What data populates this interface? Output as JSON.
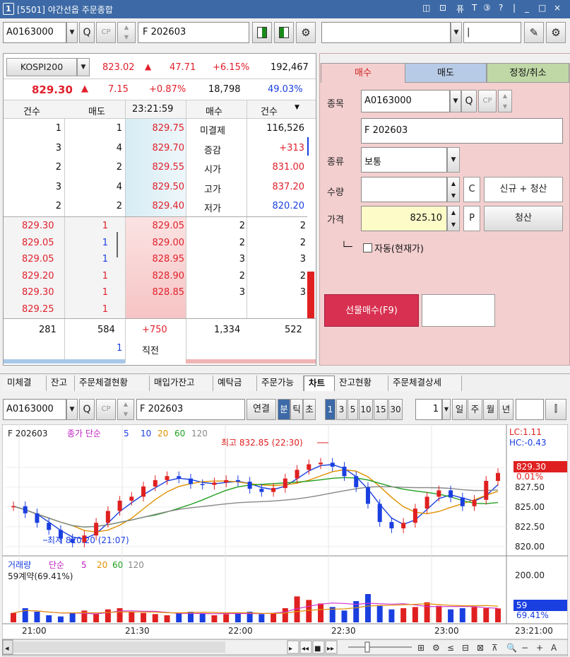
{
  "window": {
    "number": "1",
    "title": "[5501] 야간선옵 주문종합",
    "controls": [
      "◫",
      "⊡",
      "퓨",
      "T",
      "③",
      "?",
      "|",
      "_",
      "□",
      "×"
    ]
  },
  "left_toolbar": {
    "account": "A0163000",
    "product": "F 202603"
  },
  "right_toolbar": {
    "field_text": "|"
  },
  "quote": {
    "index_name": "KOSPI200",
    "index_price": "823.02",
    "index_change": "47.71",
    "index_change_pct": "+6.15%",
    "index_volume": "192,467",
    "price": "829.30",
    "change": "7.15",
    "change_pct": "+0.87%",
    "volume": "18,798",
    "ratio": "49.03%",
    "header": {
      "cnt_sell": "건수",
      "sell": "매도",
      "time": "23:21:59",
      "buy": "매수",
      "cnt_buy": "건수"
    },
    "ask_rows": [
      {
        "cnt": "1",
        "qty": "1",
        "price": "829.75",
        "label": "미결제",
        "value": "116,526"
      },
      {
        "cnt": "3",
        "qty": "4",
        "price": "829.70",
        "label": "증감",
        "value": "+313"
      },
      {
        "cnt": "2",
        "qty": "2",
        "price": "829.55",
        "label": "시가",
        "value": "831.00"
      },
      {
        "cnt": "3",
        "qty": "4",
        "price": "829.50",
        "label": "고가",
        "value": "837.20"
      },
      {
        "cnt": "2",
        "qty": "2",
        "price": "829.40",
        "label": "저가",
        "value": "820.20"
      }
    ],
    "bid_rows": [
      {
        "tick_price": "829.30",
        "tick_qty": "1",
        "price": "829.05",
        "qty": "2",
        "cnt": "2"
      },
      {
        "tick_price": "829.05",
        "tick_qty": "1",
        "price": "829.00",
        "qty": "2",
        "cnt": "2"
      },
      {
        "tick_price": "829.05",
        "tick_qty": "1",
        "price": "828.95",
        "qty": "3",
        "cnt": "3"
      },
      {
        "tick_price": "829.20",
        "tick_qty": "1",
        "price": "828.90",
        "qty": "2",
        "cnt": "2"
      },
      {
        "tick_price": "829.30",
        "tick_qty": "1",
        "price": "828.85",
        "qty": "3",
        "cnt": "3"
      },
      {
        "tick_price": "829.25",
        "tick_qty": "1"
      }
    ],
    "footer": {
      "sell_cnt": "281",
      "sell_total": "584",
      "diff": "+750",
      "buy_total": "1,334",
      "buy_cnt": "522",
      "last_qty": "1",
      "last_label": "직전"
    }
  },
  "order": {
    "tabs": [
      "매수",
      "매도",
      "정정/취소"
    ],
    "labels": {
      "symbol": "종목",
      "type": "종류",
      "qty": "수량",
      "price": "가격"
    },
    "symbol": "A0163000",
    "product": "F 202603",
    "type": "보통",
    "qty": "",
    "price": "825.10",
    "c_btn": "C",
    "p_btn": "P",
    "new_close": "신규 + 청산",
    "close": "청산",
    "auto_label": "자동(현재가)",
    "submit": "선물매수(F9)"
  },
  "bottom_tabs": [
    "미체결",
    "잔고",
    "주문체결현황",
    "매입가잔고",
    "예탁금",
    "주문가능",
    "차트",
    "잔고현황",
    "주문체결상세"
  ],
  "chart_toolbar": {
    "account": "A0163000",
    "product": "F 202603",
    "link": "연결",
    "units": [
      "분",
      "틱",
      "초"
    ],
    "intervals": [
      "1",
      "3",
      "5",
      "10",
      "15",
      "30"
    ],
    "count": "1",
    "periods": [
      "일",
      "주",
      "월",
      "년"
    ]
  },
  "price_panel": {
    "legend": {
      "name": "F 202603",
      "series": "종가 단순",
      "ma": [
        "5",
        "10",
        "20",
        "60",
        "120"
      ]
    },
    "lc": "LC:1.11",
    "hc": "HC:-0.43",
    "high_label": "최고 832.85 (22:30)",
    "low_label": "최저 820.20 (21:07)",
    "current": "829.30",
    "current_pct": "0.01%"
  },
  "volume_panel": {
    "legend": {
      "name": "거래량",
      "series": "단순",
      "ma": [
        "5",
        "20",
        "60",
        "120"
      ]
    },
    "contracts": "59계약(69.41%)",
    "current": "59",
    "current_pct": "69.41%"
  },
  "chart_data": [
    {
      "type": "line",
      "title": "F 202603",
      "ylim": [
        819,
        834.2
      ],
      "y_ticks": [
        "830.00",
        "827.50",
        "825.00",
        "822.50",
        "820.00"
      ],
      "x_ticks": [
        "21:00",
        "21:30",
        "22:00",
        "22:30",
        "23:00"
      ],
      "time_label": "23:21:00",
      "series": [
        {
          "name": "종가",
          "values": [
            825.1,
            824.2,
            823,
            822.1,
            821,
            820.5,
            821.4,
            823,
            824.5,
            825.8,
            826.3,
            827.6,
            828.4,
            828.9,
            828.6,
            827.9,
            827.8,
            828.1,
            828.4,
            828.2,
            827.3,
            826.9,
            827.4,
            828.6,
            829.7,
            830.4,
            830.6,
            830.1,
            828.9,
            827.5,
            825.4,
            823.1,
            822.3,
            823,
            824.8,
            826.3,
            827.1,
            826.2,
            825.1,
            825.9,
            828.3,
            829.3
          ]
        }
      ]
    },
    {
      "type": "bar",
      "title": "거래량",
      "ylim": [
        0,
        240
      ],
      "y_ticks": [
        "200.00"
      ],
      "series": [
        {
          "name": "거래량",
          "values": [
            40,
            60,
            45,
            30,
            25,
            40,
            50,
            35,
            55,
            60,
            45,
            40,
            35,
            30,
            40,
            45,
            38,
            30,
            35,
            40,
            45,
            35,
            40,
            60,
            110,
            95,
            80,
            65,
            50,
            90,
            120,
            70,
            55,
            60,
            65,
            85,
            70,
            55,
            60,
            65,
            60,
            59
          ]
        }
      ]
    }
  ],
  "scrollbar": {
    "left_arrow": "◂",
    "controls": [
      "▸",
      "◂◂",
      "■",
      "▸▸"
    ],
    "right_icons": [
      "⊞",
      "⚙",
      "≤",
      "⊟",
      "⊠",
      "⊼",
      "🔍",
      "−",
      "+",
      "A"
    ]
  }
}
